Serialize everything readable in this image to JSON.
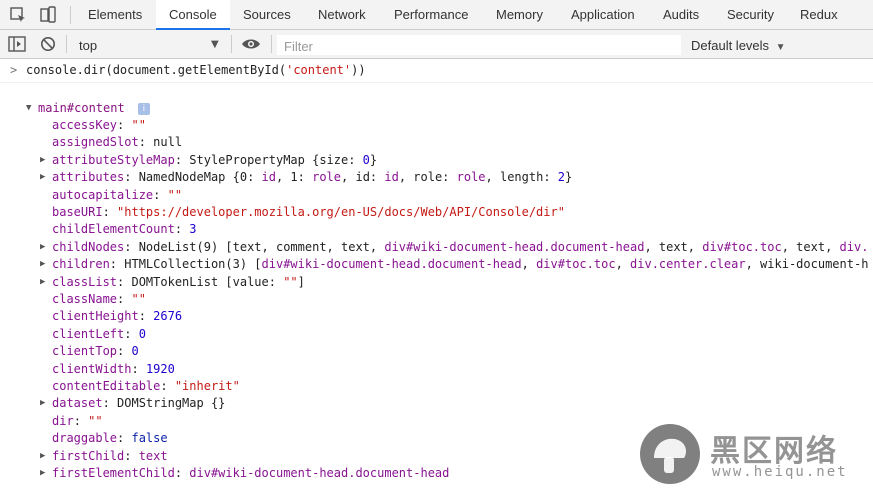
{
  "tabs": [
    "Elements",
    "Console",
    "Sources",
    "Network",
    "Performance",
    "Memory",
    "Application",
    "Audits",
    "Security",
    "Redux"
  ],
  "active_tab": "Console",
  "toolbar": {
    "context": "top",
    "filter_placeholder": "Filter",
    "levels": "Default levels"
  },
  "console": {
    "prompt": ">",
    "command": "console.dir(document.getElementById('content'))",
    "root": "main#content",
    "info_badge": "i",
    "props": [
      {
        "expand": false,
        "key": "accessKey",
        "sep": ": ",
        "parts": [
          [
            "s",
            "\"\""
          ]
        ]
      },
      {
        "expand": false,
        "key": "assignedSlot",
        "sep": ": ",
        "parts": [
          [
            "t",
            "null"
          ]
        ]
      },
      {
        "expand": true,
        "key": "attributeStyleMap",
        "sep": ": ",
        "parts": [
          [
            "t",
            "StylePropertyMap {size: "
          ],
          [
            "n",
            "0"
          ],
          [
            "t",
            "}"
          ]
        ]
      },
      {
        "expand": true,
        "key": "attributes",
        "sep": ": ",
        "parts": [
          [
            "t",
            "NamedNodeMap {0: "
          ],
          [
            "k",
            "id"
          ],
          [
            "t",
            ", 1: "
          ],
          [
            "k",
            "role"
          ],
          [
            "t",
            ", id: "
          ],
          [
            "k",
            "id"
          ],
          [
            "t",
            ", role: "
          ],
          [
            "k",
            "role"
          ],
          [
            "t",
            ", length: "
          ],
          [
            "n",
            "2"
          ],
          [
            "t",
            "}"
          ]
        ]
      },
      {
        "expand": false,
        "key": "autocapitalize",
        "sep": ": ",
        "parts": [
          [
            "s",
            "\"\""
          ]
        ]
      },
      {
        "expand": false,
        "key": "baseURI",
        "sep": ": ",
        "parts": [
          [
            "s",
            "\"https://developer.mozilla.org/en-US/docs/Web/API/Console/dir\""
          ]
        ]
      },
      {
        "expand": false,
        "key": "childElementCount",
        "sep": ": ",
        "parts": [
          [
            "n",
            "3"
          ]
        ]
      },
      {
        "expand": true,
        "key": "childNodes",
        "sep": ": ",
        "parts": [
          [
            "t",
            "NodeList(9) [text, comment, text, "
          ],
          [
            "k",
            "div#wiki-document-head.document-head"
          ],
          [
            "t",
            ", text, "
          ],
          [
            "k",
            "div#toc.toc"
          ],
          [
            "t",
            ", text, "
          ],
          [
            "k",
            "div."
          ]
        ]
      },
      {
        "expand": true,
        "key": "children",
        "sep": ": ",
        "parts": [
          [
            "t",
            "HTMLCollection(3) ["
          ],
          [
            "k",
            "div#wiki-document-head.document-head"
          ],
          [
            "t",
            ", "
          ],
          [
            "k",
            "div#toc.toc"
          ],
          [
            "t",
            ", "
          ],
          [
            "k",
            "div.center.clear"
          ],
          [
            "t",
            ", wiki-document-h"
          ]
        ]
      },
      {
        "expand": true,
        "key": "classList",
        "sep": ": ",
        "parts": [
          [
            "t",
            "DOMTokenList [value: "
          ],
          [
            "s",
            "\"\""
          ],
          [
            "t",
            "]"
          ]
        ]
      },
      {
        "expand": false,
        "key": "className",
        "sep": ": ",
        "parts": [
          [
            "s",
            "\"\""
          ]
        ]
      },
      {
        "expand": false,
        "key": "clientHeight",
        "sep": ": ",
        "parts": [
          [
            "n",
            "2676"
          ]
        ]
      },
      {
        "expand": false,
        "key": "clientLeft",
        "sep": ": ",
        "parts": [
          [
            "n",
            "0"
          ]
        ]
      },
      {
        "expand": false,
        "key": "clientTop",
        "sep": ": ",
        "parts": [
          [
            "n",
            "0"
          ]
        ]
      },
      {
        "expand": false,
        "key": "clientWidth",
        "sep": ": ",
        "parts": [
          [
            "n",
            "1920"
          ]
        ]
      },
      {
        "expand": false,
        "key": "contentEditable",
        "sep": ": ",
        "parts": [
          [
            "s",
            "\"inherit\""
          ]
        ]
      },
      {
        "expand": true,
        "key": "dataset",
        "sep": ": ",
        "parts": [
          [
            "t",
            "DOMStringMap {}"
          ]
        ]
      },
      {
        "expand": false,
        "key": "dir",
        "sep": ": ",
        "parts": [
          [
            "s",
            "\"\""
          ]
        ]
      },
      {
        "expand": false,
        "key": "draggable",
        "sep": ": ",
        "parts": [
          [
            "kw",
            "false"
          ]
        ]
      },
      {
        "expand": true,
        "key": "firstChild",
        "sep": ": ",
        "parts": [
          [
            "k",
            "text"
          ]
        ]
      },
      {
        "expand": true,
        "key": "firstElementChild",
        "sep": ": ",
        "parts": [
          [
            "k",
            "div#wiki-document-head.document-head"
          ]
        ]
      }
    ]
  },
  "watermark": {
    "title": "黑区网络",
    "url": "www.heiqu.net"
  }
}
